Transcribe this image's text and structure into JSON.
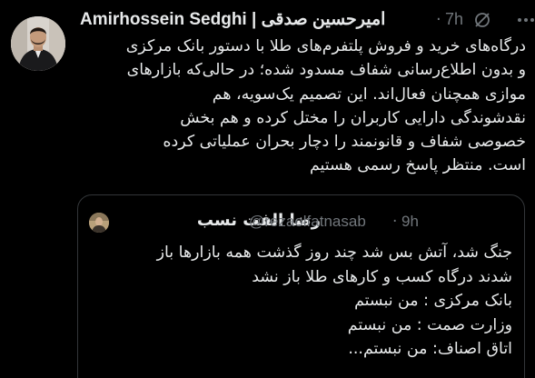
{
  "colors": {
    "background": "#000000",
    "text_primary": "#e7e9ea",
    "text_secondary": "#71767b",
    "border": "#333639"
  },
  "tweet": {
    "author_name": "Amirhossein Sedghi | امیرحسین صدقی",
    "separator": "·",
    "time": "7h",
    "body_lines": [
      "درگاه‌های خرید و فروش پلتفرم‌های طلا با دستور بانک مرکزی",
      "و بدون اطلاع‌رسانی شفاف مسدود شده؛ در حالی‌که بازارهای",
      "موازی همچنان فعال‌اند. این تصمیم یک‌سویه، هم",
      "نقدشوندگی دارایی کاربران را مختل کرده و هم بخش",
      "خصوصی شفاف و قانونمند را دچار بحران عملیاتی کرده",
      "است. منتظر پاسخ رسمی هستیم"
    ]
  },
  "quoted": {
    "author_name": "رضا الفت نسب",
    "handle": "@rezaolfatnasab",
    "separator": "·",
    "time": "9h",
    "body_lines": [
      "جنگ شد، آتش بس شد چند روز گذشت همه بازارها باز",
      "شدند درگاه کسب و کارهای طلا باز نشد",
      "بانک مرکزی : من نبستم",
      "وزارت صمت : من نبستم",
      "اتاق اصناف: من نبستم..."
    ]
  },
  "icons": {
    "edit_status": "no-edit-icon",
    "menu": "more-icon"
  }
}
